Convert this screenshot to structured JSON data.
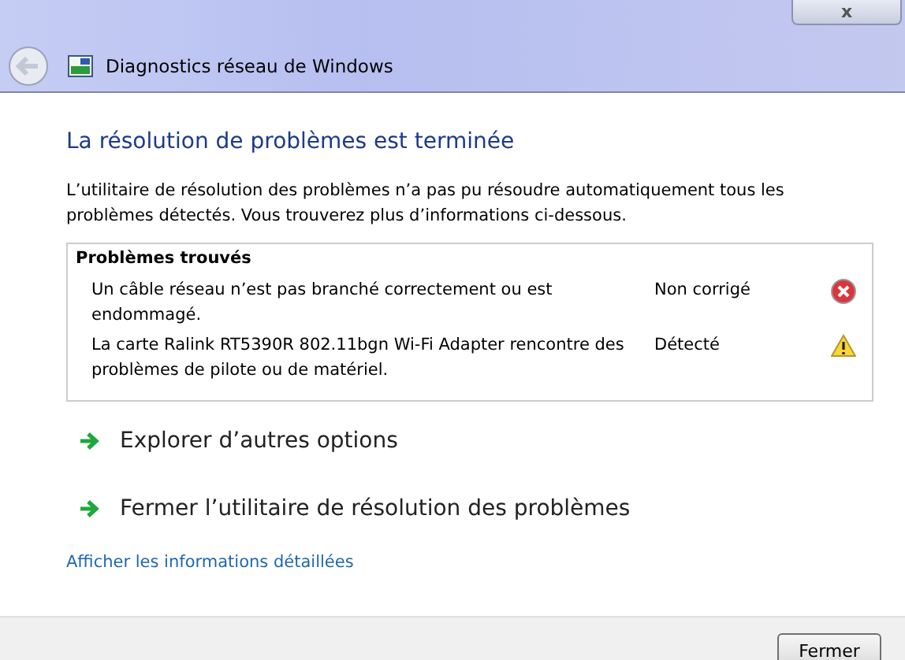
{
  "window": {
    "title": "Diagnostics réseau de Windows",
    "close": "x"
  },
  "heading": "La résolution de problèmes est terminée",
  "description": "L’utilitaire de résolution des problèmes n’a pas pu résoudre automatiquement tous les problèmes détectés. Vous trouverez plus d’informations ci-dessous.",
  "problems": {
    "title": "Problèmes trouvés",
    "rows": [
      {
        "text": "Un câble réseau n’est pas branché correctement ou est endommagé.",
        "status": "Non corrigé",
        "kind": "error"
      },
      {
        "text": "La carte Ralink RT5390R 802.11bgn Wi-Fi Adapter rencontre des problèmes de pilote ou de matériel.",
        "status": "Détecté",
        "kind": "warning"
      }
    ]
  },
  "options": [
    "Explorer d’autres options",
    "Fermer l’utilitaire de résolution des problèmes"
  ],
  "details_link": "Afficher les informations détaillées",
  "buttons": [
    "Fermer"
  ]
}
